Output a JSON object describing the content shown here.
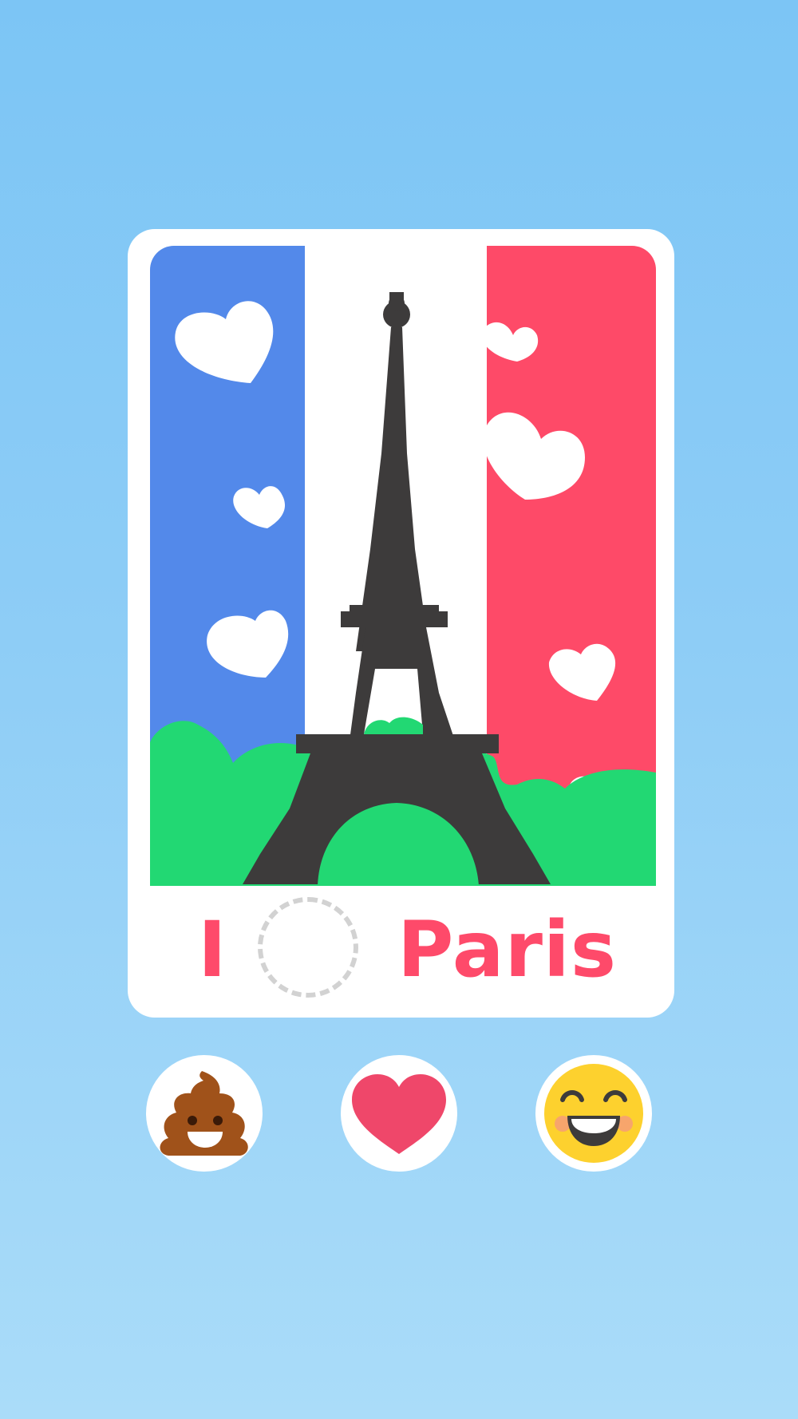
{
  "card": {
    "illustration": "eiffel-tower-on-french-flag",
    "colors": {
      "flag_blue": "#5389ea",
      "flag_white": "#ffffff",
      "flag_red": "#fe4a68",
      "tower": "#3d3b3b",
      "bushes": "#22d873",
      "hearts": "#ffffff"
    },
    "caption": {
      "word_before": "I",
      "blank": "",
      "word_after": "Paris",
      "color": "#fe4a6a"
    }
  },
  "choices": [
    {
      "icon": "poop-emoji-icon",
      "color": "#a0521a"
    },
    {
      "icon": "heart-icon",
      "color": "#ef476a"
    },
    {
      "icon": "grinning-face-emoji-icon",
      "color": "#fdd12e"
    }
  ]
}
